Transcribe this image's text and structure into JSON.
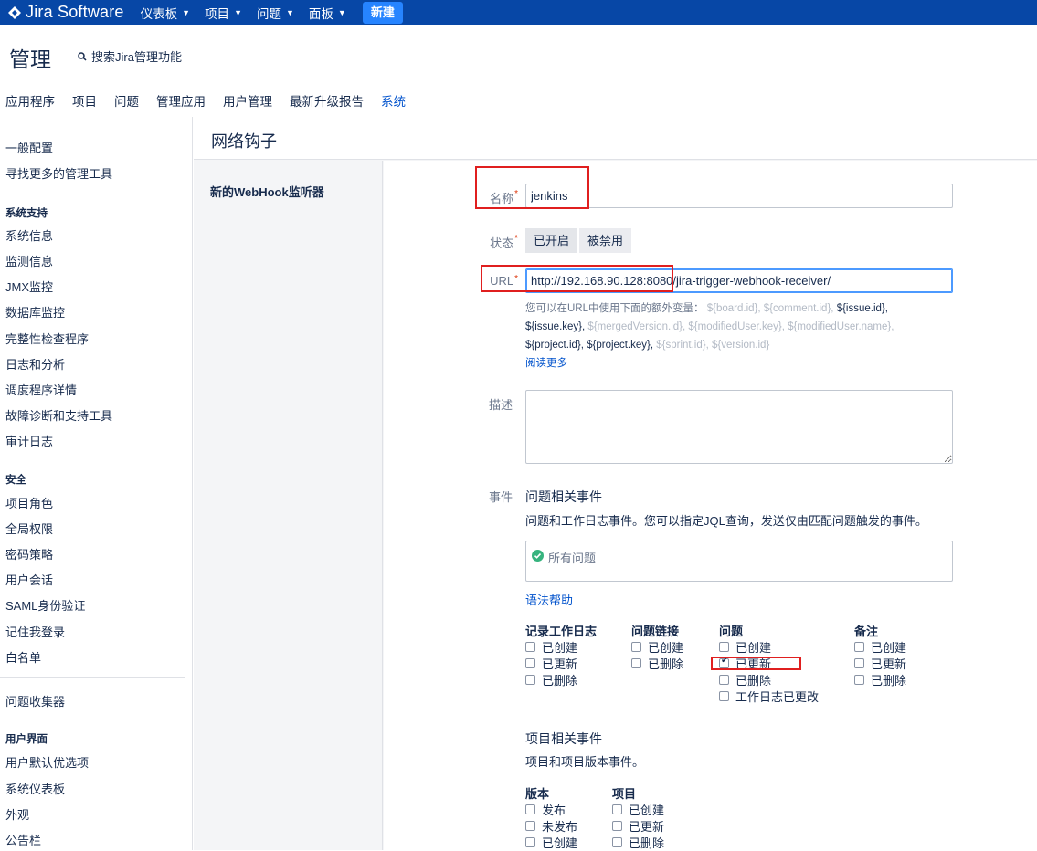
{
  "topnav": {
    "logo_text": "Jira Software",
    "items": [
      {
        "label": "仪表板"
      },
      {
        "label": "项目"
      },
      {
        "label": "问题"
      },
      {
        "label": "面板"
      }
    ],
    "create_label": "新建"
  },
  "admin": {
    "title": "管理",
    "search_label": "搜索Jira管理功能",
    "tabs": [
      "应用程序",
      "项目",
      "问题",
      "管理应用",
      "用户管理",
      "最新升级报告",
      "系统"
    ],
    "active_tab": "系统"
  },
  "sidebar": {
    "general": [
      "一般配置",
      "寻找更多的管理工具"
    ],
    "system_support_heading": "系统支持",
    "system_support": [
      "系统信息",
      "监测信息",
      "JMX监控",
      "数据库监控",
      "完整性检查程序",
      "日志和分析",
      "调度程序详情",
      "故障诊断和支持工具",
      "审计日志"
    ],
    "security_heading": "安全",
    "security": [
      "项目角色",
      "全局权限",
      "密码策略",
      "用户会话",
      "SAML身份验证",
      "记住我登录",
      "白名单"
    ],
    "collector": "问题收集器",
    "ui_heading": "用户界面",
    "ui": [
      "用户默认优选项",
      "系统仪表板",
      "外观",
      "公告栏"
    ]
  },
  "page": {
    "title": "网络钩子",
    "pane_title": "新的WebHook监听器"
  },
  "form": {
    "name_label": "名称",
    "name_value": "jenkins",
    "status_label": "状态",
    "status_on": "已开启",
    "status_off": "被禁用",
    "url_label": "URL",
    "url_value": "http://192.168.90.128:8080/jira-trigger-webhook-receiver/",
    "help_intro": "您可以在URL中使用下面的额外变量：",
    "vars": [
      {
        "text": "${board.id},",
        "used": false
      },
      {
        "text": "${comment.id},",
        "used": false
      },
      {
        "text": "${issue.id},",
        "used": true
      },
      {
        "text": "${issue.key},",
        "used": true
      },
      {
        "text": "${mergedVersion.id},",
        "used": false
      },
      {
        "text": "${modifiedUser.key},",
        "used": false
      },
      {
        "text": "${modifiedUser.name},",
        "used": false
      },
      {
        "text": "${project.id},",
        "used": true
      },
      {
        "text": "${project.key},",
        "used": true
      },
      {
        "text": "${sprint.id},",
        "used": false
      },
      {
        "text": "${version.id}",
        "used": false
      }
    ],
    "read_more": "阅读更多",
    "desc_label": "描述",
    "events_label": "事件",
    "issue_events_heading": "问题相关事件",
    "issue_events_desc": "问题和工作日志事件。您可以指定JQL查询，发送仅由匹配问题触发的事件。",
    "jql_placeholder": "所有问题",
    "syntax_help": "语法帮助",
    "issue_columns": [
      {
        "title": "记录工作日志",
        "items": [
          {
            "label": "已创建",
            "checked": false
          },
          {
            "label": "已更新",
            "checked": false
          },
          {
            "label": "已删除",
            "checked": false
          }
        ]
      },
      {
        "title": "问题链接",
        "items": [
          {
            "label": "已创建",
            "checked": false
          },
          {
            "label": "已删除",
            "checked": false
          }
        ]
      },
      {
        "title": "问题",
        "items": [
          {
            "label": "已创建",
            "checked": false
          },
          {
            "label": "已更新",
            "checked": true
          },
          {
            "label": "已删除",
            "checked": false
          },
          {
            "label": "工作日志已更改",
            "checked": false
          }
        ]
      },
      {
        "title": "备注",
        "items": [
          {
            "label": "已创建",
            "checked": false
          },
          {
            "label": "已更新",
            "checked": false
          },
          {
            "label": "已删除",
            "checked": false
          }
        ]
      }
    ],
    "project_events_heading": "项目相关事件",
    "project_events_desc": "项目和项目版本事件。",
    "project_columns": [
      {
        "title": "版本",
        "items": [
          {
            "label": "发布",
            "checked": false
          },
          {
            "label": "未发布",
            "checked": false
          },
          {
            "label": "已创建",
            "checked": false
          }
        ]
      },
      {
        "title": "项目",
        "items": [
          {
            "label": "已创建",
            "checked": false
          },
          {
            "label": "已更新",
            "checked": false
          },
          {
            "label": "已删除",
            "checked": false
          }
        ]
      }
    ]
  },
  "colors": {
    "nav_bg": "#0747a6",
    "create_btn": "#2684ff",
    "link": "#0052cc",
    "annotation": "#e01f1f"
  }
}
